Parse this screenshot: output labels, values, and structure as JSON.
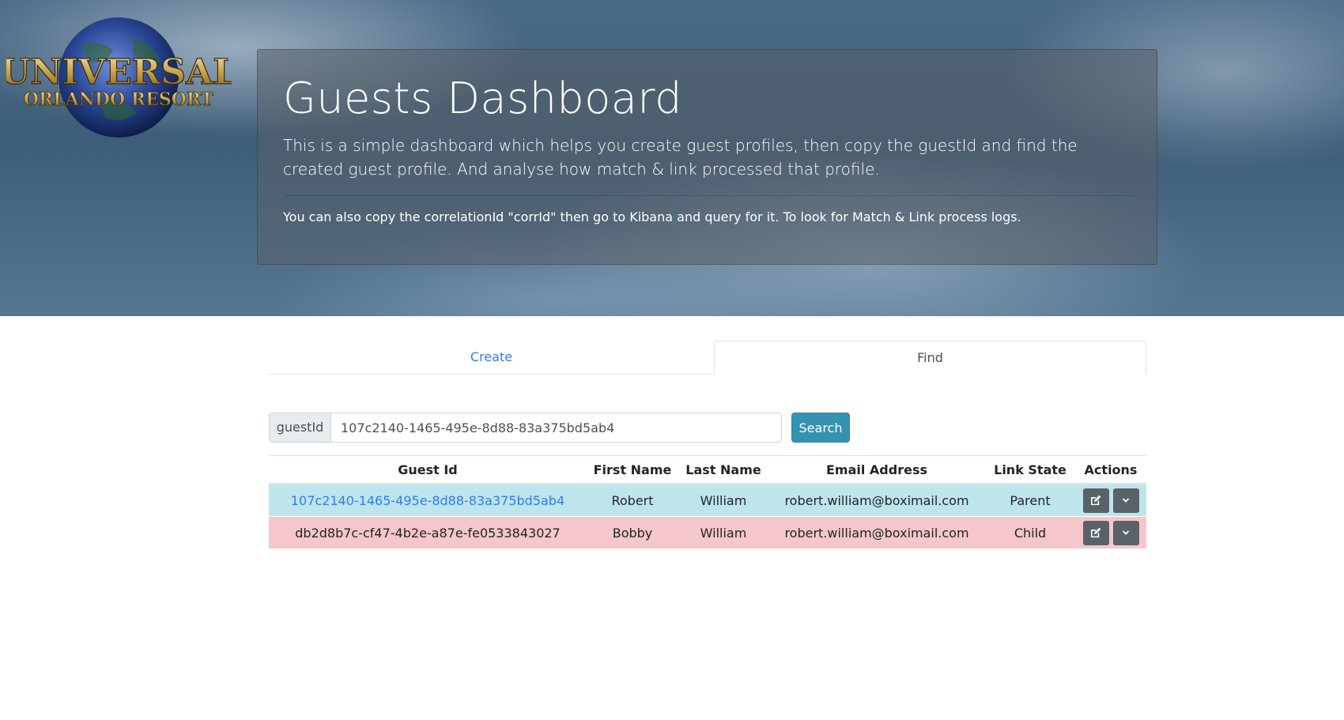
{
  "header": {
    "logo_text_top": "UNIVERSAL",
    "logo_text_bottom": "ORLANDO RESORT",
    "title": "Guests Dashboard",
    "lead": "This is a simple dashboard which helps you create guest profiles, then copy the guestId and find the created guest profile. And analyse how match & link processed that profile.",
    "note": "You can also copy the correlationId \"corrId\" then go to Kibana and query for it. To look for Match & Link process logs."
  },
  "tabs": [
    {
      "label": "Create",
      "active": false
    },
    {
      "label": "Find",
      "active": true
    }
  ],
  "search": {
    "addon_label": "guestId",
    "value": "107c2140-1465-495e-8d88-83a375bd5ab4",
    "button_label": "Search"
  },
  "table": {
    "headers": [
      "Guest Id",
      "First Name",
      "Last Name",
      "Email Address",
      "Link State",
      "Actions"
    ],
    "rows": [
      {
        "guest_id": "107c2140-1465-495e-8d88-83a375bd5ab4",
        "first_name": "Robert",
        "last_name": "William",
        "email": "robert.william@boximail.com",
        "link_state": "Parent"
      },
      {
        "guest_id": "db2d8b7c-cf47-4b2e-a87e-fe0533843027",
        "first_name": "Bobby",
        "last_name": "William",
        "email": "robert.william@boximail.com",
        "link_state": "Child"
      }
    ]
  },
  "icons": {
    "edit": "edit-icon",
    "expand": "chevron-down-icon"
  },
  "colors": {
    "link_blue": "#2f7bff",
    "search_button": "#3592b0",
    "parent_row": "#bee5eb",
    "child_row": "#f5c6cb",
    "action_button": "#5a6268"
  }
}
